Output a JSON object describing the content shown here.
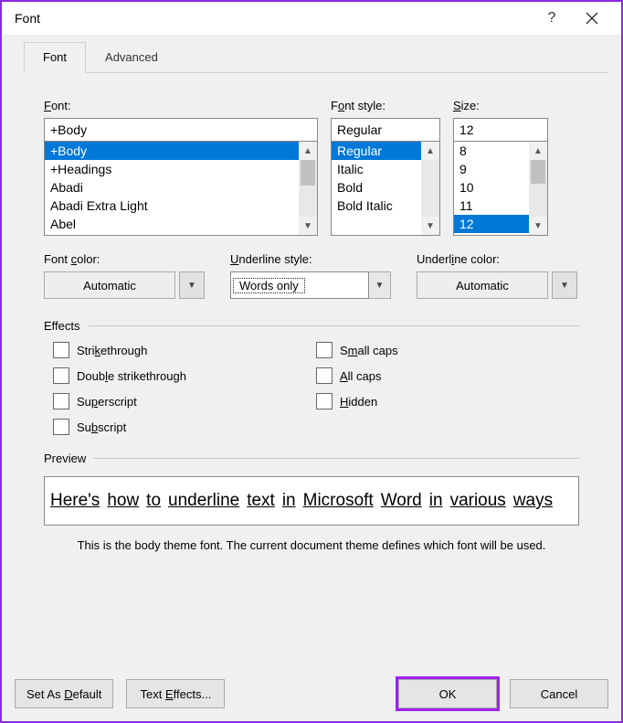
{
  "title": "Font",
  "tabs": {
    "font": "Font",
    "advanced": "Advanced"
  },
  "fontSection": {
    "label_html": "<span class='ul'>F</span>ont:",
    "value": "+Body",
    "list": [
      "+Body",
      "+Headings",
      "Abadi",
      "Abadi Extra Light",
      "Abel"
    ],
    "selected_index": 0
  },
  "styleSection": {
    "label_html": "F<span class='ul'>o</span>nt style:",
    "value": "Regular",
    "list": [
      "Regular",
      "Italic",
      "Bold",
      "Bold Italic"
    ],
    "selected_index": 0
  },
  "sizeSection": {
    "label_html": "<span class='ul'>S</span>ize:",
    "value": "12",
    "list": [
      "8",
      "9",
      "10",
      "11",
      "12"
    ],
    "selected_index": 4
  },
  "fontColor": {
    "label_html": "Font <span class='ul'>c</span>olor:",
    "value": "Automatic"
  },
  "ulStyle": {
    "label_html": "<span class='ul'>U</span>nderline style:",
    "value": "Words only"
  },
  "ulColor": {
    "label_html": "Underl<span class='ul'>i</span>ne color:",
    "value": "Automatic"
  },
  "effectsLabel": "Effects",
  "effects": {
    "strikethrough_html": "Stri<span class='ul'>k</span>ethrough",
    "dblstrike_html": "Doub<span class='ul'>l</span>e strikethrough",
    "superscript_html": "Su<span class='ul'>p</span>erscript",
    "subscript_html": "Su<span class='ul'>b</span>script",
    "smallcaps_html": "S<span class='ul'>m</span>all caps",
    "allcaps_html": "<span class='ul'>A</span>ll caps",
    "hidden_html": "<span class='ul'>H</span>idden"
  },
  "previewLabel": "Preview",
  "previewWords": [
    "Here's",
    "how",
    "to",
    "underline",
    "text",
    "in",
    "Microsoft",
    "Word",
    "in",
    "various",
    "ways"
  ],
  "previewDesc": "This is the body theme font. The current document theme defines which font will be used.",
  "footer": {
    "setdefault_html": "Set As <span class='ul'>D</span>efault",
    "texteffects_html": "Text <span class='ul'>E</span>ffects...",
    "ok": "OK",
    "cancel": "Cancel"
  }
}
